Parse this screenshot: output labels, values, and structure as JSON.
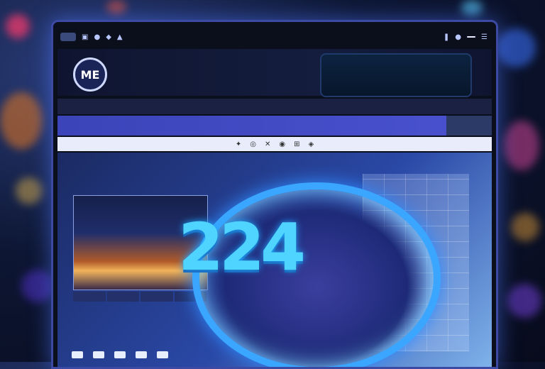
{
  "topbar": {
    "left_pill": "",
    "right_text": ""
  },
  "header": {
    "logo_text": "ME",
    "brand": "",
    "badge_title": "",
    "badge_sub": [
      "",
      "",
      ""
    ]
  },
  "nav": {
    "items_left": [
      "",
      "",
      ""
    ],
    "items_right": [
      "",
      "",
      ""
    ]
  },
  "subbar": {
    "label": "",
    "center_line1": "",
    "center_line2": "",
    "button": ""
  },
  "content": {
    "heading": "",
    "line": "",
    "big_number": "224",
    "footer": ""
  }
}
